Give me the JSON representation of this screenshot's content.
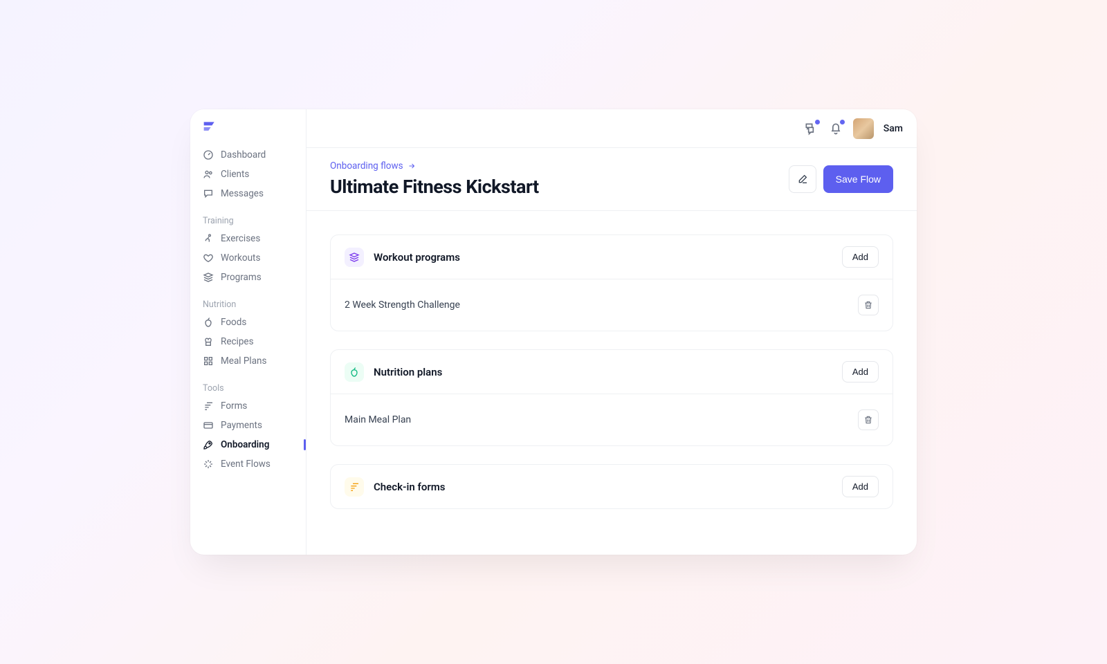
{
  "sidebar": {
    "main": [
      {
        "label": "Dashboard",
        "icon": "gauge"
      },
      {
        "label": "Clients",
        "icon": "users"
      },
      {
        "label": "Messages",
        "icon": "chat"
      }
    ],
    "groups": [
      {
        "heading": "Training",
        "items": [
          {
            "label": "Exercises",
            "icon": "run"
          },
          {
            "label": "Workouts",
            "icon": "heart"
          },
          {
            "label": "Programs",
            "icon": "stack"
          }
        ]
      },
      {
        "heading": "Nutrition",
        "items": [
          {
            "label": "Foods",
            "icon": "apple"
          },
          {
            "label": "Recipes",
            "icon": "chef"
          },
          {
            "label": "Meal Plans",
            "icon": "grid"
          }
        ]
      },
      {
        "heading": "Tools",
        "items": [
          {
            "label": "Forms",
            "icon": "form"
          },
          {
            "label": "Payments",
            "icon": "card"
          },
          {
            "label": "Onboarding",
            "icon": "rocket",
            "active": true
          },
          {
            "label": "Event Flows",
            "icon": "sparkle"
          }
        ]
      }
    ]
  },
  "topbar": {
    "user_name": "Sam"
  },
  "header": {
    "breadcrumb": "Onboarding flows",
    "title": "Ultimate Fitness Kickstart",
    "save_label": "Save Flow"
  },
  "sections": [
    {
      "title": "Workout programs",
      "icon_class": "purple",
      "add_label": "Add",
      "items": [
        {
          "name": "2 Week Strength Challenge"
        }
      ]
    },
    {
      "title": "Nutrition plans",
      "icon_class": "green",
      "add_label": "Add",
      "items": [
        {
          "name": "Main Meal Plan"
        }
      ]
    },
    {
      "title": "Check-in forms",
      "icon_class": "amber",
      "add_label": "Add",
      "items": []
    }
  ]
}
